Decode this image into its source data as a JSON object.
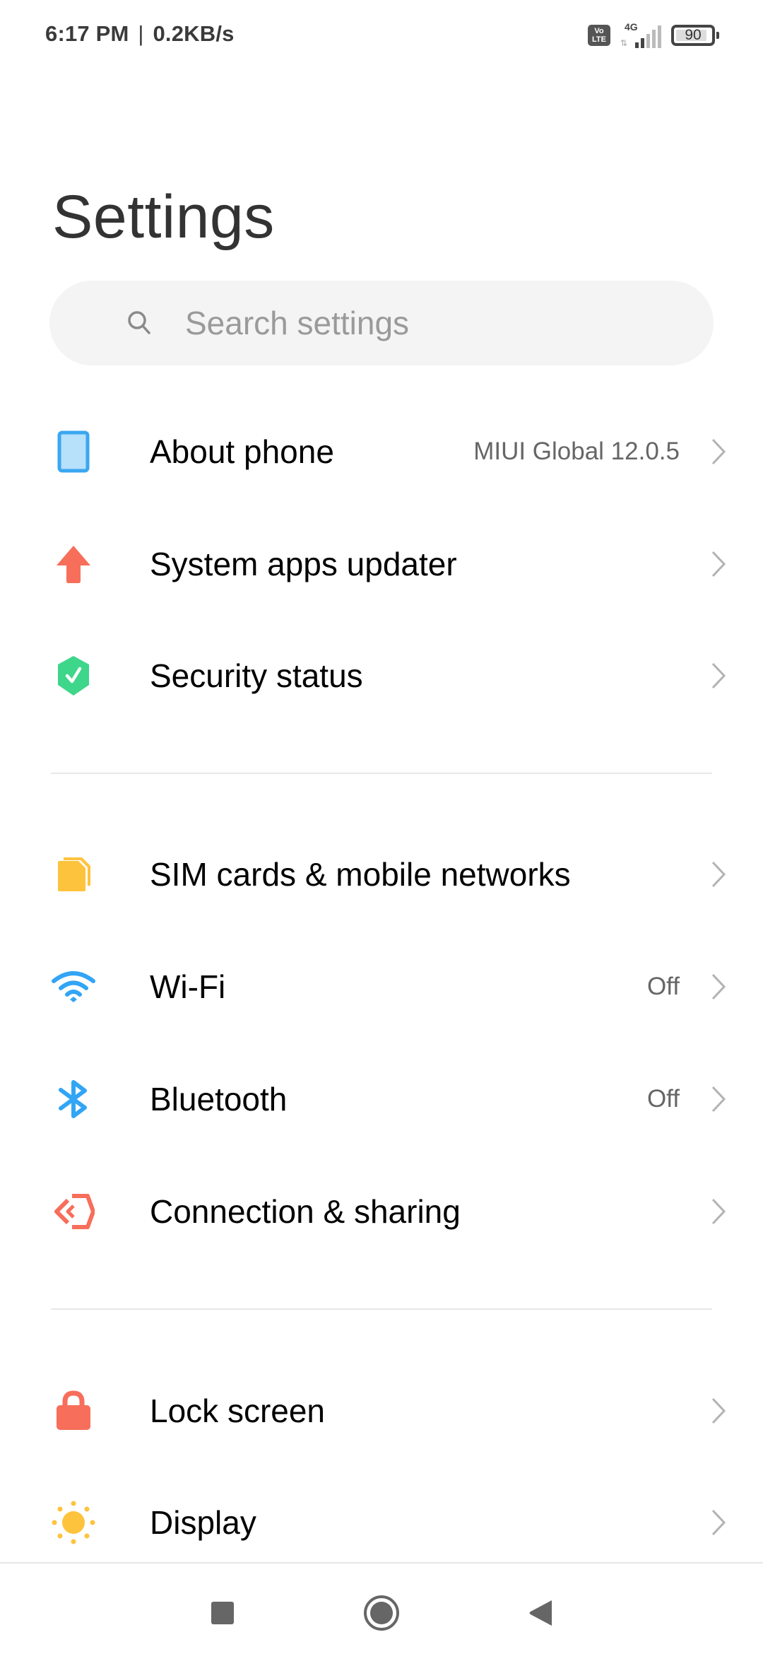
{
  "status_bar": {
    "time": "6:17 PM",
    "separator": "|",
    "net_speed": "0.2KB/s",
    "volte_top": "Vo",
    "volte_bottom": "LTE",
    "network_type": "4G",
    "signal_level": 2,
    "signal_max": 5,
    "battery_percent": "90",
    "battery_level": 0.9
  },
  "header": {
    "title": "Settings"
  },
  "search": {
    "placeholder": "Search settings",
    "value": ""
  },
  "sections": [
    {
      "items": [
        {
          "label": "About phone",
          "value": "MIUI Global 12.0.5",
          "icon": "phone-icon",
          "color": "#3aa7f0"
        },
        {
          "label": "System apps updater",
          "value": "",
          "icon": "arrow-up-icon",
          "color": "#f76e5a"
        },
        {
          "label": "Security status",
          "value": "",
          "icon": "shield-check-icon",
          "color": "#3ed68a"
        }
      ]
    },
    {
      "items": [
        {
          "label": "SIM cards & mobile networks",
          "value": "",
          "icon": "sim-card-icon",
          "color": "#fec33d"
        },
        {
          "label": "Wi-Fi",
          "value": "Off",
          "icon": "wifi-icon",
          "color": "#32a5f5"
        },
        {
          "label": "Bluetooth",
          "value": "Off",
          "icon": "bluetooth-icon",
          "color": "#32a5f5"
        },
        {
          "label": "Connection & sharing",
          "value": "",
          "icon": "connection-sharing-icon",
          "color": "#f76e5a"
        }
      ]
    },
    {
      "items": [
        {
          "label": "Lock screen",
          "value": "",
          "icon": "lock-icon",
          "color": "#f76e5a"
        },
        {
          "label": "Display",
          "value": "",
          "icon": "sun-icon",
          "color": "#fec33d"
        }
      ]
    }
  ],
  "nav_bar": {
    "recents": "recents-button",
    "home": "home-button",
    "back": "back-button"
  }
}
